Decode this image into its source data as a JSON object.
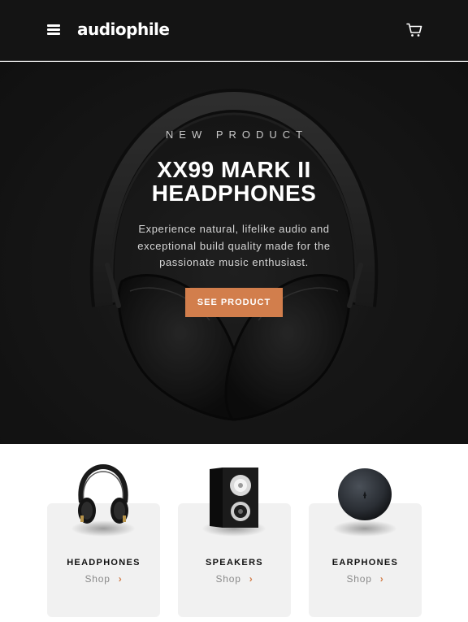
{
  "header": {
    "logo": "audiophile",
    "menu_icon": "hamburger-menu-icon",
    "cart_icon": "shopping-cart-icon"
  },
  "hero": {
    "eyebrow": "NEW PRODUCT",
    "title": "XX99 MARK II HEADPHONES",
    "description": "Experience natural, lifelike audio and exceptional build quality made for the passionate music enthusiast.",
    "cta_label": "SEE PRODUCT"
  },
  "categories": [
    {
      "name": "HEADPHONES",
      "shop_label": "Shop"
    },
    {
      "name": "SPEAKERS",
      "shop_label": "Shop"
    },
    {
      "name": "EARPHONES",
      "shop_label": "Shop"
    }
  ],
  "colors": {
    "accent": "#d27e4c",
    "header_bg": "#141414",
    "hero_bg": "#191919",
    "card_bg": "#f1f1f1"
  }
}
